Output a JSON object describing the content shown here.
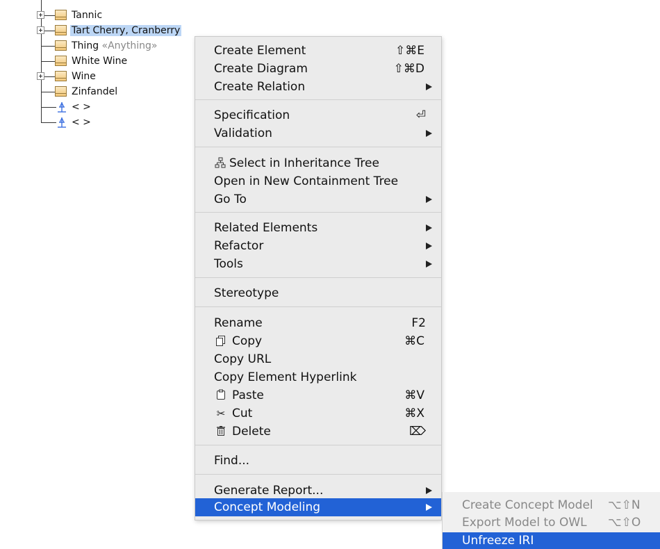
{
  "tree": {
    "items": [
      {
        "label": "Tannic",
        "expandable": true
      },
      {
        "label": "Tart Cherry, Cranberry",
        "expandable": true,
        "selected": true
      },
      {
        "label": "Thing",
        "stereotype": "«Anything»",
        "expandable": false
      },
      {
        "label": "White Wine",
        "expandable": false
      },
      {
        "label": "Wine",
        "expandable": true
      },
      {
        "label": "Zinfandel",
        "expandable": false
      },
      {
        "label": "< >",
        "kind": "association"
      },
      {
        "label": "< >",
        "kind": "association"
      }
    ]
  },
  "menu": {
    "create_element": {
      "label": "Create Element",
      "shortcut": "⇧⌘E"
    },
    "create_diagram": {
      "label": "Create Diagram",
      "shortcut": "⇧⌘D"
    },
    "create_relation": {
      "label": "Create Relation"
    },
    "specification": {
      "label": "Specification",
      "shortcut": "⏎"
    },
    "validation": {
      "label": "Validation"
    },
    "select_inheritance": {
      "label": "Select in Inheritance Tree"
    },
    "open_containment": {
      "label": "Open in New Containment Tree"
    },
    "go_to": {
      "label": "Go To"
    },
    "related_elements": {
      "label": "Related Elements"
    },
    "refactor": {
      "label": "Refactor"
    },
    "tools": {
      "label": "Tools"
    },
    "stereotype": {
      "label": "Stereotype"
    },
    "rename": {
      "label": "Rename",
      "shortcut": "F2"
    },
    "copy": {
      "label": "Copy",
      "shortcut": "⌘C"
    },
    "copy_url": {
      "label": "Copy URL"
    },
    "copy_hyperlink": {
      "label": "Copy Element Hyperlink"
    },
    "paste": {
      "label": "Paste",
      "shortcut": "⌘V"
    },
    "cut": {
      "label": "Cut",
      "shortcut": "⌘X"
    },
    "delete": {
      "label": "Delete",
      "shortcut": "⌦"
    },
    "find": {
      "label": "Find..."
    },
    "generate_report": {
      "label": "Generate Report..."
    },
    "concept_modeling": {
      "label": "Concept Modeling"
    }
  },
  "submenu": {
    "create_concept_model": {
      "label": "Create Concept Model",
      "shortcut": "⌥⇧N"
    },
    "export_owl": {
      "label": "Export Model to OWL",
      "shortcut": "⌥⇧O"
    },
    "unfreeze_iri": {
      "label": "Unfreeze IRI"
    }
  },
  "colors": {
    "highlight": "#2262d6",
    "selection": "#bcd6f5",
    "menu_bg": "#ebebeb"
  }
}
